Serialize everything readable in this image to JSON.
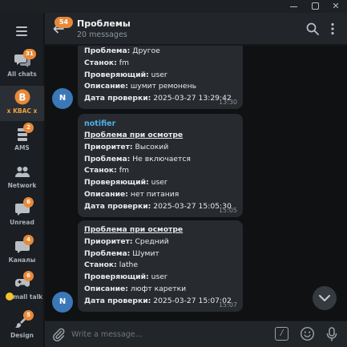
{
  "window": {
    "minimize_glyph": "",
    "close_glyph": "✕"
  },
  "sidebar": {
    "menu_icon": "hamburger-icon",
    "folders": [
      {
        "label": "All chats",
        "badge": "31",
        "icon": "chat-bubbles-icon",
        "active": false
      },
      {
        "label": "x KBAC x",
        "badge": "",
        "icon": "bitcoin-icon",
        "active": true
      },
      {
        "label": "AMS",
        "badge": "2",
        "icon": "stacked-layers-icon",
        "active": false
      },
      {
        "label": "Network",
        "badge": "",
        "icon": "people-icon",
        "active": false
      },
      {
        "label": "Unread",
        "badge": "6",
        "icon": "unread-chat-icon",
        "active": false
      },
      {
        "label": "Каналы",
        "badge": "4",
        "icon": "channel-icon",
        "active": false
      },
      {
        "label": "small talk",
        "badge": "6",
        "icon": "game-controller-icon",
        "active": false
      },
      {
        "label": "Design",
        "badge": "5",
        "icon": "brush-icon",
        "active": false
      }
    ]
  },
  "header": {
    "back_icon": "arrow-left-icon",
    "unread_badge": "54",
    "title": "Проблемы",
    "subtitle": "20 messages",
    "search_icon": "search-icon",
    "more_icon": "more-vertical-icon"
  },
  "messages": [
    {
      "sender": "",
      "avatar": "N",
      "time": "13:30",
      "lines": [
        {
          "label": "Проблема:",
          "value": "Другое"
        },
        {
          "label": "Станок:",
          "value": "fm"
        },
        {
          "label": "Проверяющий:",
          "value": "user"
        },
        {
          "label": "Описание:",
          "value": "шумит ремонень"
        },
        {
          "label": "Дата проверки:",
          "value": "2025-03-27 13:29:42"
        }
      ]
    },
    {
      "sender": "notifier",
      "avatar": "",
      "time": "15:05",
      "title": "Проблема при осмотре",
      "lines": [
        {
          "label": "Приоритет:",
          "value": "Высокий"
        },
        {
          "label": "Проблема:",
          "value": "Не включается"
        },
        {
          "label": "Станок:",
          "value": "fm"
        },
        {
          "label": "Проверяющий:",
          "value": "user"
        },
        {
          "label": "Описание:",
          "value": "нет питания"
        },
        {
          "label": "Дата проверки:",
          "value": "2025-03-27 15:05:30"
        }
      ]
    },
    {
      "sender": "",
      "avatar": "N",
      "time": "15:07",
      "title": "Проблема при осмотре",
      "lines": [
        {
          "label": "Приоритет:",
          "value": "Средний"
        },
        {
          "label": "Проблема:",
          "value": "Шумит"
        },
        {
          "label": "Станок:",
          "value": "lathe"
        },
        {
          "label": "Проверяющий:",
          "value": "user"
        },
        {
          "label": "Описание:",
          "value": "люфт каретки"
        },
        {
          "label": "Дата проверки:",
          "value": "2025-03-27 15:07:02"
        }
      ]
    }
  ],
  "composer": {
    "placeholder": "Write a message...",
    "attach_icon": "paperclip-icon",
    "commands_glyph": "/",
    "emoji_icon": "smiley-icon",
    "mic_icon": "microphone-icon"
  },
  "colors": {
    "accent": "#e7893a",
    "sender": "#4fb0e8",
    "bubble": "#272b30",
    "background": "#0f1113"
  }
}
